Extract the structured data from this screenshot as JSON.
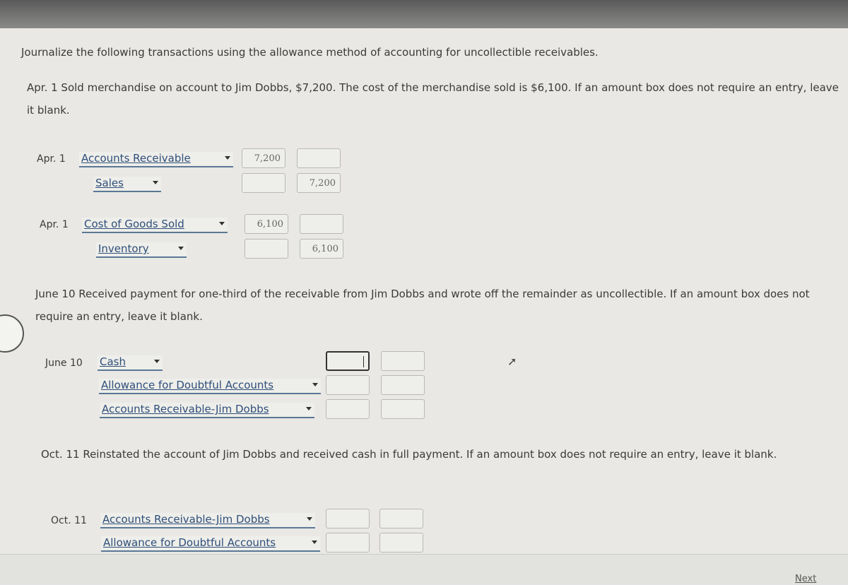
{
  "instructions": "Journalize the following transactions using the allowance method of accounting for uncollectible receivables.",
  "transactions": [
    {
      "prompt": "Apr. 1 Sold merchandise on account to Jim Dobbs, $7,200. The cost of the merchandise sold is $6,100. If an amount box does not require an entry, leave it blank."
    },
    {
      "prompt": "June 10 Received payment for one-third of the receivable from Jim Dobbs and wrote off the remainder as uncollectible. If an amount box does not require an entry, leave it blank."
    },
    {
      "prompt": "Oct. 11 Reinstated the account of Jim Dobbs and received cash in full payment. If an amount box does not require an entry, leave it blank."
    }
  ],
  "entries": {
    "e1": {
      "date": "Apr. 1",
      "rows": [
        {
          "account": "Accounts Receivable",
          "debit": "7,200",
          "credit": ""
        },
        {
          "account": "Sales",
          "debit": "",
          "credit": "7,200"
        }
      ]
    },
    "e2": {
      "date": "Apr. 1",
      "rows": [
        {
          "account": "Cost of Goods Sold",
          "debit": "6,100",
          "credit": ""
        },
        {
          "account": "Inventory",
          "debit": "",
          "credit": "6,100"
        }
      ]
    },
    "e3": {
      "date": "June 10",
      "rows": [
        {
          "account": "Cash",
          "debit": "",
          "credit": ""
        },
        {
          "account": "Allowance for Doubtful Accounts",
          "debit": "",
          "credit": ""
        },
        {
          "account": "Accounts Receivable-Jim Dobbs",
          "debit": "",
          "credit": ""
        }
      ]
    },
    "e4": {
      "date": "Oct. 11",
      "rows": [
        {
          "account": "Accounts Receivable-Jim Dobbs",
          "debit": "",
          "credit": ""
        },
        {
          "account": "Allowance for Doubtful Accounts",
          "debit": "",
          "credit": ""
        }
      ]
    }
  },
  "nav": {
    "next": "Next"
  }
}
